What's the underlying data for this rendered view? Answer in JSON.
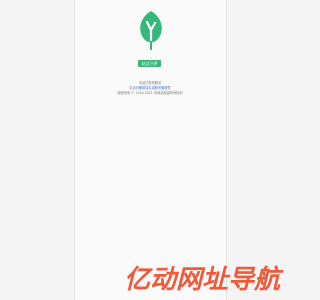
{
  "status": {
    "button_label": "站点已停",
    "line1": "本站已暂停服务",
    "line2": "请访问备用域名或联系管理员",
    "line3": "版权所有 © 2016-2021 本网站保留所有权利"
  },
  "watermark": {
    "text": "亿动网址导航",
    "color": "#f05a3a"
  },
  "colors": {
    "logo_green": "#35b97a",
    "button_green": "#35b97a"
  },
  "icons": {
    "logo": "tree-leaf-icon"
  }
}
